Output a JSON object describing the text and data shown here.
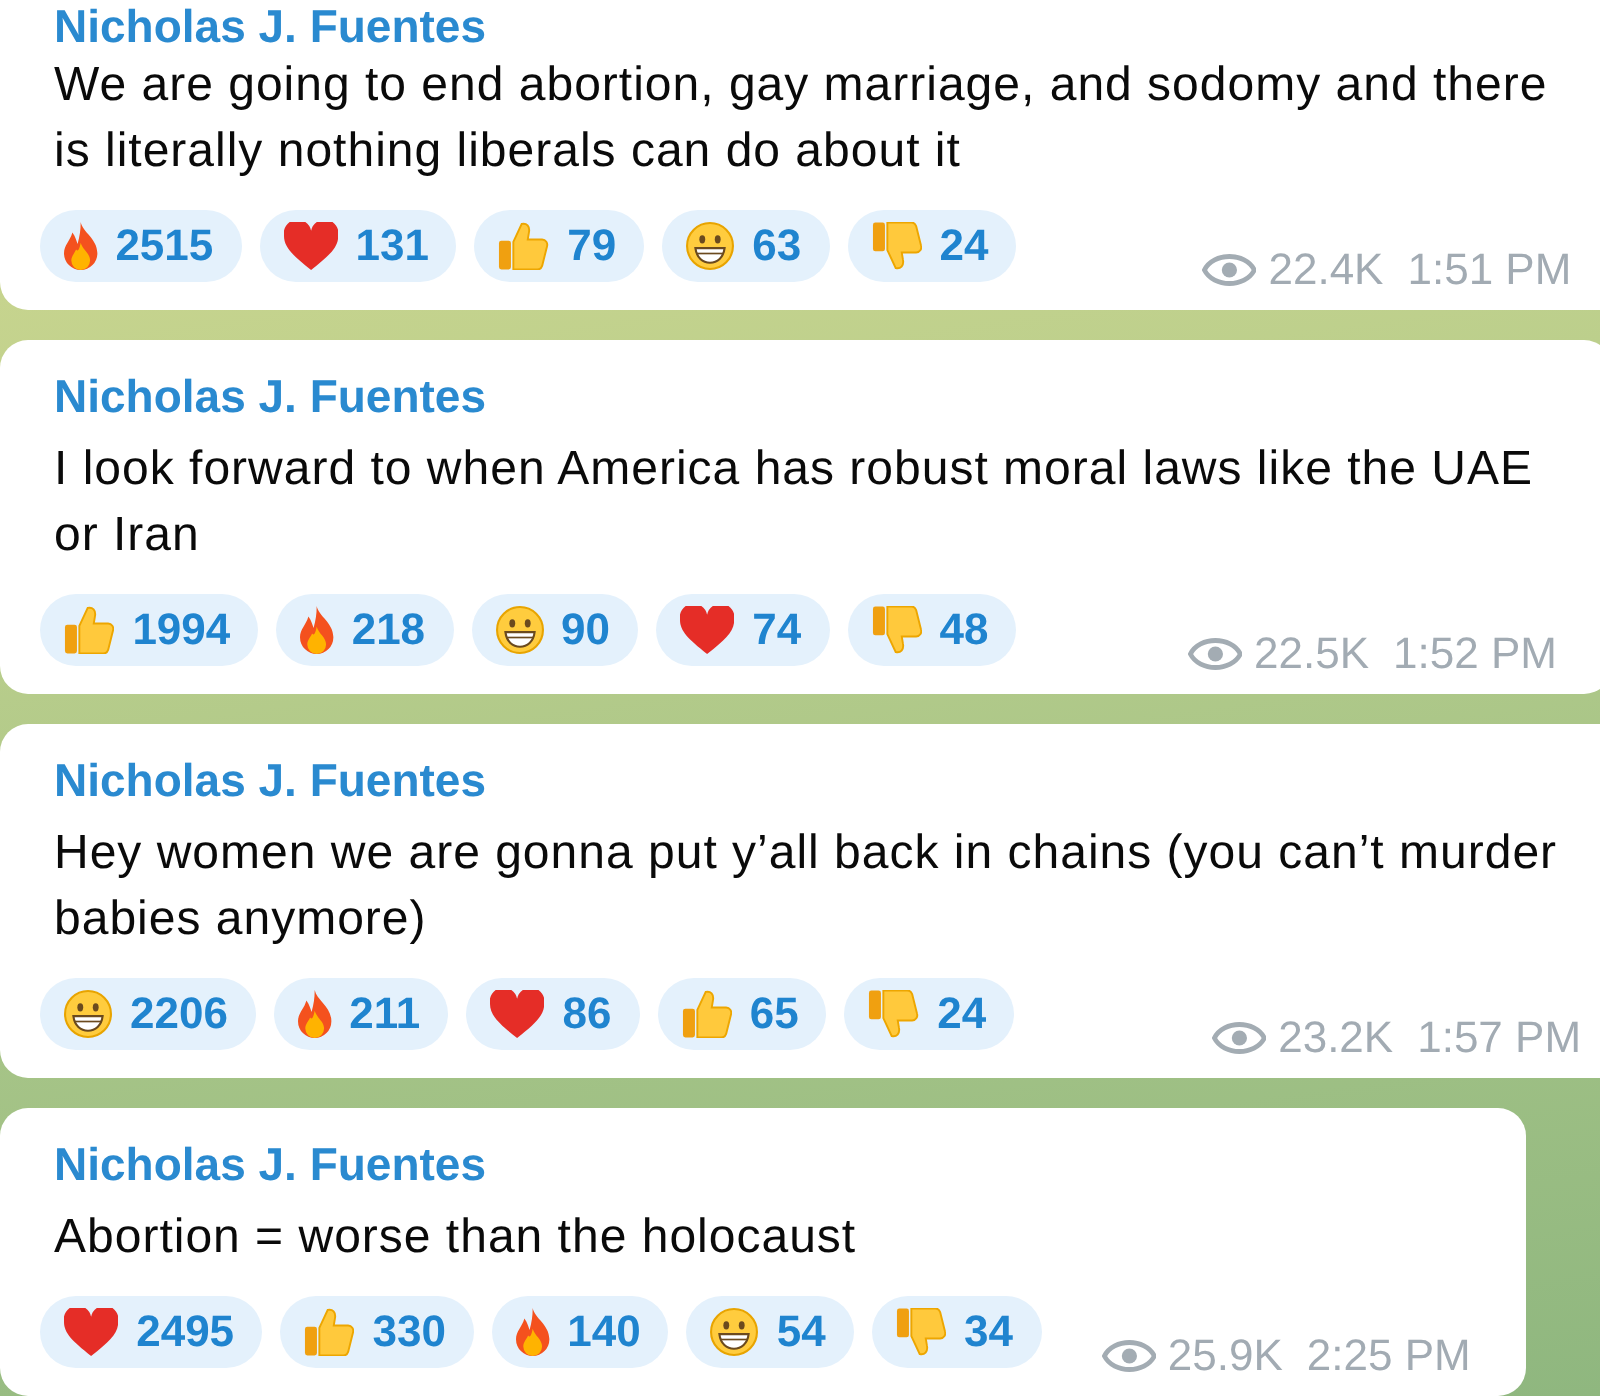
{
  "messages": [
    {
      "sender": "Nicholas J. Fuentes",
      "text": "We are going to end abortion, gay marriage, and sodomy and there\nis literally nothing liberals can do about it",
      "reactions": [
        {
          "kind": "fire",
          "count": "2515"
        },
        {
          "kind": "heart",
          "count": "131"
        },
        {
          "kind": "thumbs_up",
          "count": "79"
        },
        {
          "kind": "grin",
          "count": "63"
        },
        {
          "kind": "thumbs_down",
          "count": "24"
        }
      ],
      "views": "22.4K",
      "time": "1:51 PM"
    },
    {
      "sender": "Nicholas J. Fuentes",
      "text": "I look forward to when America has robust moral laws like the UAE\nor Iran",
      "reactions": [
        {
          "kind": "thumbs_up",
          "count": "1994"
        },
        {
          "kind": "fire",
          "count": "218"
        },
        {
          "kind": "grin",
          "count": "90"
        },
        {
          "kind": "heart",
          "count": "74"
        },
        {
          "kind": "thumbs_down",
          "count": "48"
        }
      ],
      "views": "22.5K",
      "time": "1:52 PM"
    },
    {
      "sender": "Nicholas J. Fuentes",
      "text": "Hey women we are gonna put y’all back in chains (you can’t murder\nbabies anymore)",
      "reactions": [
        {
          "kind": "grin",
          "count": "2206"
        },
        {
          "kind": "fire",
          "count": "211"
        },
        {
          "kind": "heart",
          "count": "86"
        },
        {
          "kind": "thumbs_up",
          "count": "65"
        },
        {
          "kind": "thumbs_down",
          "count": "24"
        }
      ],
      "views": "23.2K",
      "time": "1:57 PM"
    },
    {
      "sender": "Nicholas J. Fuentes",
      "text": "Abortion = worse than the holocaust",
      "reactions": [
        {
          "kind": "heart",
          "count": "2495"
        },
        {
          "kind": "thumbs_up",
          "count": "330"
        },
        {
          "kind": "fire",
          "count": "140"
        },
        {
          "kind": "grin",
          "count": "54"
        },
        {
          "kind": "thumbs_down",
          "count": "34"
        }
      ],
      "views": "25.9K",
      "time": "2:25 PM"
    }
  ]
}
